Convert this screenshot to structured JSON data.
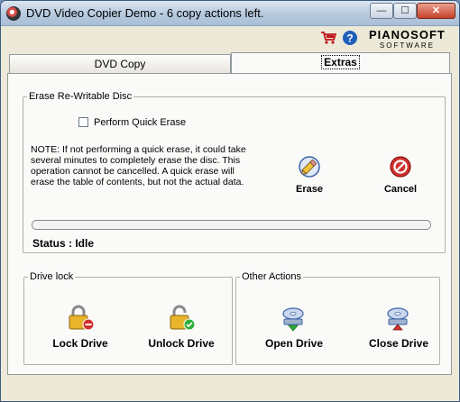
{
  "window": {
    "title": "DVD Video Copier Demo - 6 copy actions left.",
    "controls": {
      "minimize": "—",
      "maximize": "☐",
      "close": "✕"
    }
  },
  "brand": {
    "name": "PIANOSOFT",
    "tagline": "SOFTWARE"
  },
  "toolbar": {
    "icons": [
      "cart-icon",
      "help-icon"
    ]
  },
  "tabs": [
    {
      "label": "DVD Copy",
      "active": false
    },
    {
      "label": "Extras",
      "active": true
    }
  ],
  "erase": {
    "group_label": "Erase Re-Writable Disc",
    "quick_erase_label": "Perform Quick Erase",
    "quick_erase_checked": false,
    "note": "NOTE: If not performing a quick erase, it could take several minutes to completely erase the disc. This operation cannot be cancelled. A quick erase will erase the table of contents, but not the actual data.",
    "erase_label": "Erase",
    "cancel_label": "Cancel",
    "progress": 0.0,
    "status": "Status : Idle"
  },
  "drive_lock": {
    "group_label": "Drive lock",
    "lock_label": "Lock Drive",
    "unlock_label": "Unlock Drive"
  },
  "other_actions": {
    "group_label": "Other Actions",
    "open_label": "Open Drive",
    "close_label": "Close Drive"
  },
  "colors": {
    "progress": "#4bb348",
    "accent_red": "#d0312d",
    "accent_green": "#2fae3a"
  }
}
